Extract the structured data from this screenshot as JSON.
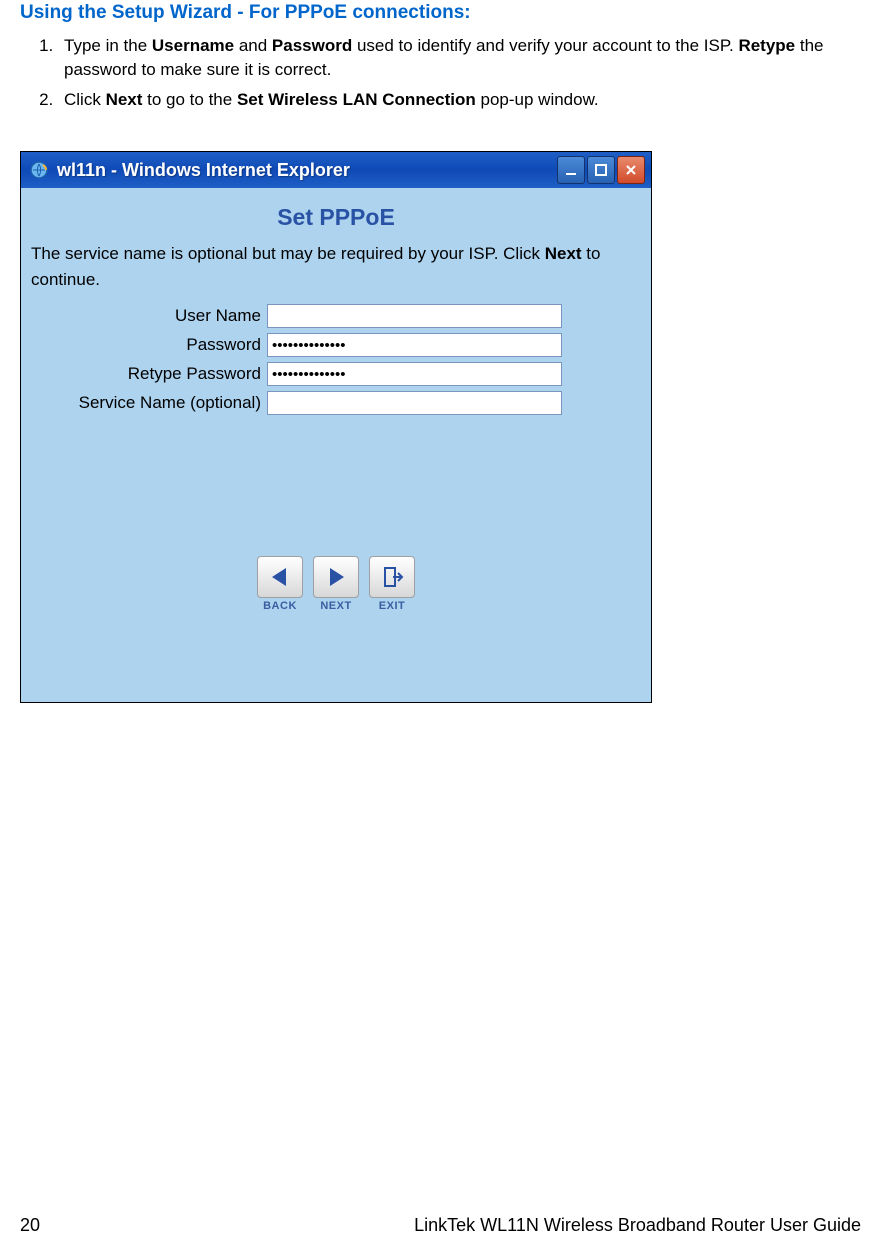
{
  "heading": "Using the Setup Wizard - For PPPoE connections:",
  "steps": {
    "s1a": "Type in the ",
    "s1b": "Username",
    "s1c": " and ",
    "s1d": "Password",
    "s1e": " used to identify and verify your account to the ISP. ",
    "s1f": "Retype",
    "s1g": " the password to make sure it is correct.",
    "s2a": "Click ",
    "s2b": "Next",
    "s2c": " to go to the ",
    "s2d": "Set Wireless LAN Connection",
    "s2e": " pop-up window."
  },
  "window": {
    "title": "wl11n - Windows Internet Explorer",
    "wizard_title": "Set PPPoE",
    "desc1": "The service name is optional but may be required by your ISP. Click ",
    "desc2": "Next",
    "desc3": " to continue.",
    "labels": {
      "user": "User Name",
      "pass": "Password",
      "retype": "Retype Password",
      "service": "Service Name (optional)"
    },
    "values": {
      "user": "",
      "pass": "••••••••••••••",
      "retype": "••••••••••••••",
      "service": ""
    },
    "nav": {
      "back": "BACK",
      "next": "NEXT",
      "exit": "EXIT"
    }
  },
  "footer": {
    "page": "20",
    "guide": "LinkTek WL11N Wireless Broadband Router User Guide"
  }
}
